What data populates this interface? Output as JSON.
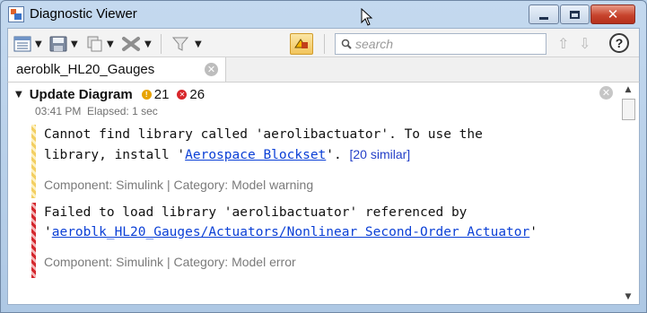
{
  "window": {
    "title": "Diagnostic Viewer",
    "close_symbol": "✕"
  },
  "toolbar": {
    "search_placeholder": "search",
    "help_symbol": "?",
    "caret_symbol": "▼",
    "nav_up_symbol": "⇧",
    "nav_down_symbol": "⇩",
    "icons": [
      "view-icon",
      "save-icon",
      "copy-icon",
      "clear-icon",
      "filter-icon",
      "highlight-icon",
      "search-icon",
      "up-arrow-icon",
      "down-arrow-icon",
      "help-icon"
    ]
  },
  "tab": {
    "label": "aeroblk_HL20_Gauges",
    "close_symbol": "✕"
  },
  "group": {
    "expand_symbol": "▼",
    "title": "Update Diagram",
    "warning_count": "21",
    "error_count": "26",
    "time": "03:41 PM",
    "elapsed": "Elapsed: 1 sec",
    "close_symbol": "✕"
  },
  "messages": [
    {
      "kind": "warning",
      "line1": "Cannot find library called 'aerolibactuator'.  To use the",
      "line2_prefix": "library, install '",
      "link": "Aerospace Blockset",
      "line2_suffix": "'. ",
      "similar": "[20 similar]",
      "component": "Component: Simulink | Category: Model warning"
    },
    {
      "kind": "error",
      "line1": "Failed to load library 'aerolibactuator' referenced by",
      "line2_prefix": "'",
      "link": "aeroblk_HL20_Gauges/Actuators/Nonlinear Second-Order Actuator",
      "line2_suffix": "'",
      "component": "Component: Simulink | Category: Model error"
    }
  ],
  "scrollbar": {
    "up_symbol": "▲",
    "down_symbol": "▼"
  },
  "colors": {
    "warning": "#e8a300",
    "error": "#d8262b",
    "link": "#0a3fd6"
  }
}
